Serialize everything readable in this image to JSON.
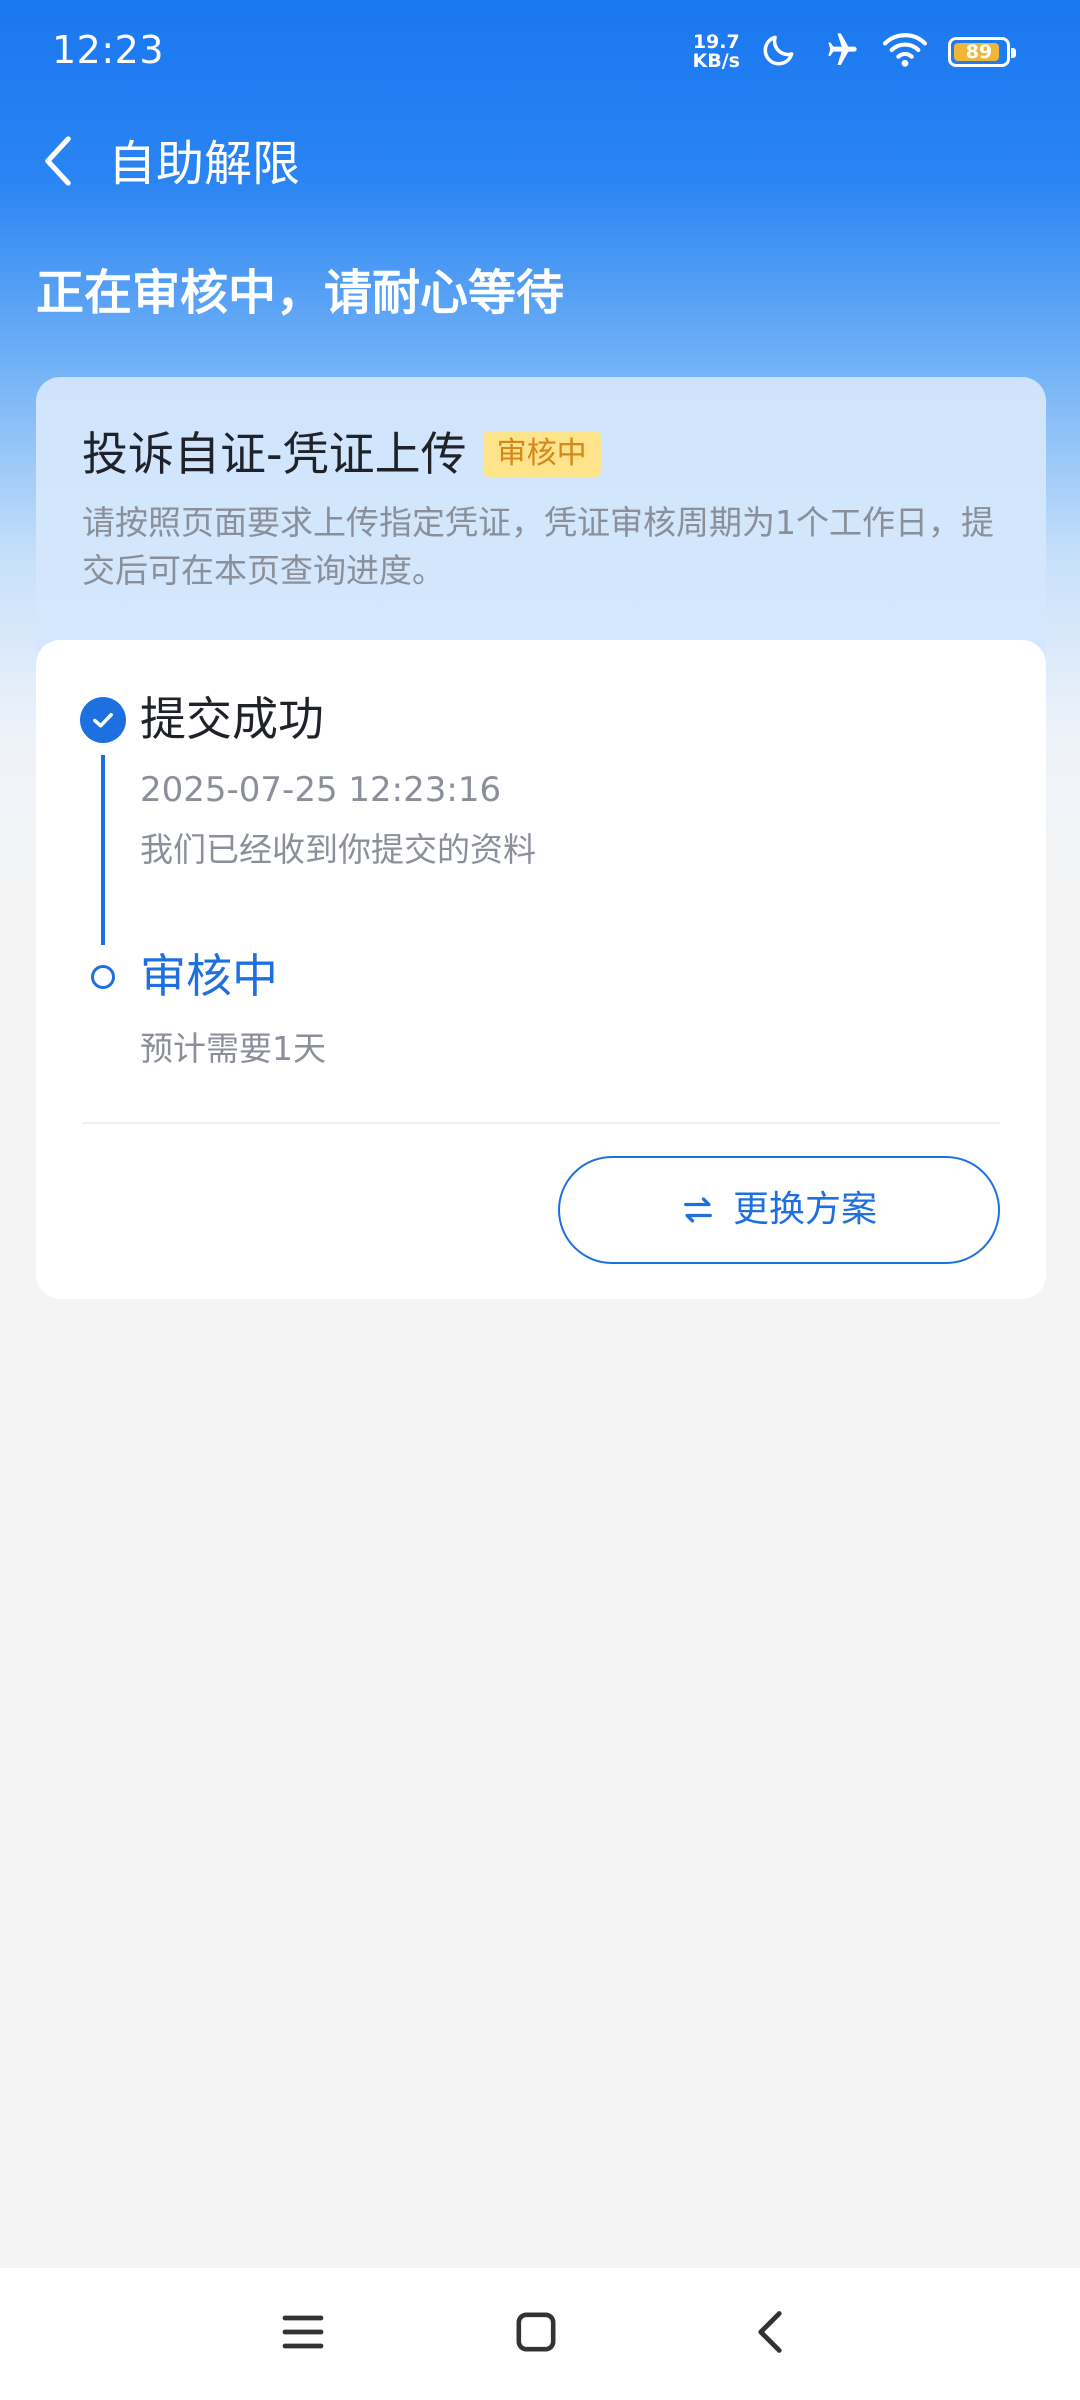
{
  "status_bar": {
    "time": "12:23",
    "net_speed_value": "19.7",
    "net_speed_unit": "KB/s",
    "battery_percent": "89",
    "battery_level": 0.89,
    "battery_color": "#f0b63a"
  },
  "header": {
    "title": "自助解限"
  },
  "headline": "正在审核中，请耐心等待",
  "card": {
    "title": "投诉自证-凭证上传",
    "badge": "审核中",
    "description": "请按照页面要求上传指定凭证，凭证审核周期为1个工作日，提交后可在本页查询进度。",
    "steps": [
      {
        "title": "提交成功",
        "time": "2025-07-25 12:23:16",
        "desc": "我们已经收到你提交的资料",
        "icon": "check-circle-icon"
      },
      {
        "title": "审核中",
        "desc": "预计需要1天",
        "icon": "hollow-circle-icon"
      }
    ],
    "switch_button_label": "更换方案"
  },
  "colors": {
    "accent": "#1e6fe0",
    "badge_bg": "#fde48a",
    "badge_text": "#d7861a"
  },
  "nav": {
    "icons": [
      "menu-icon",
      "home-icon",
      "back-icon"
    ]
  }
}
